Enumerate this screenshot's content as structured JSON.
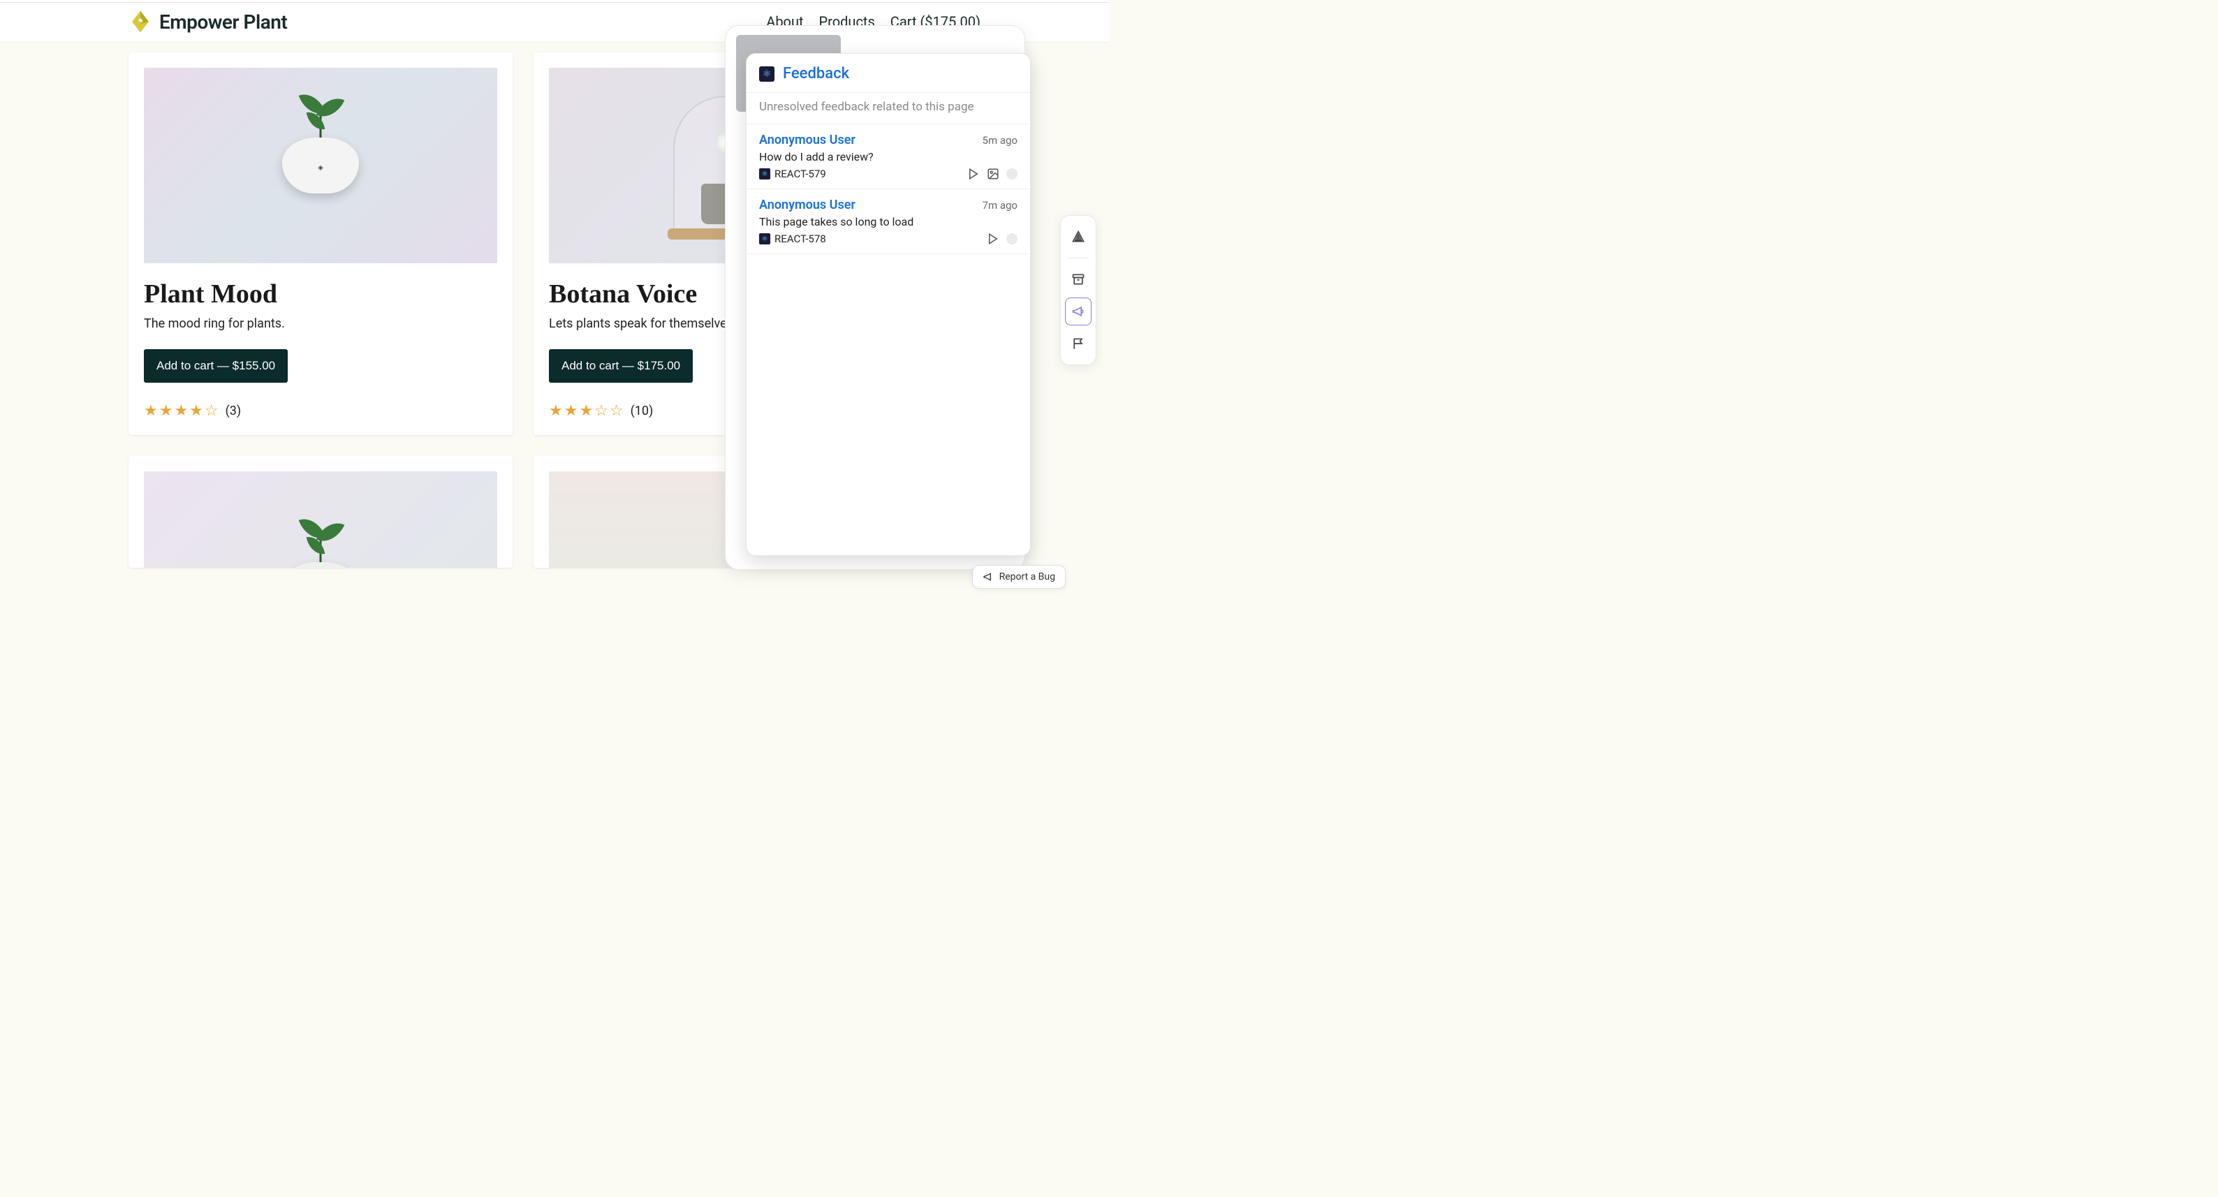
{
  "brand": {
    "name": "Empower Plant"
  },
  "nav": {
    "about": "About",
    "products": "Products",
    "cart": "Cart ($175.00)"
  },
  "products": [
    {
      "title": "Plant Mood",
      "desc": "The mood ring for plants.",
      "cta": "Add to cart — $155.00",
      "stars_full": 4,
      "stars_empty": 1,
      "count": "(3)"
    },
    {
      "title": "Botana Voice",
      "desc": "Lets plants speak for themselves.",
      "cta": "Add to cart — $175.00",
      "stars_full": 3,
      "stars_empty": 2,
      "count": "(10)"
    }
  ],
  "feedback": {
    "title": "Feedback",
    "subtitle": "Unresolved feedback related to this page",
    "items": [
      {
        "user": "Anonymous User",
        "time": "5m ago",
        "message": "How do I add a review?",
        "tag": "REACT-579",
        "has_image": true
      },
      {
        "user": "Anonymous User",
        "time": "7m ago",
        "message": "This page takes so long to load",
        "tag": "REACT-578",
        "has_image": false
      }
    ]
  },
  "toolbar": {
    "sentry": "sentry-icon",
    "archive": "archive-icon",
    "megaphone": "megaphone-icon",
    "flag": "flag-icon"
  },
  "report_bug": {
    "label": "Report a Bug"
  }
}
